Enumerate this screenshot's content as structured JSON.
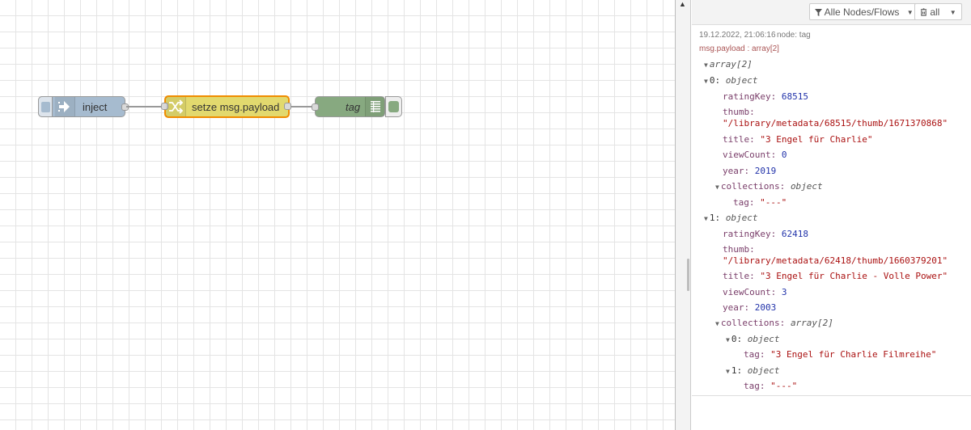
{
  "nodes": {
    "inject": {
      "label": "inject"
    },
    "change": {
      "label": "setze msg.payload"
    },
    "debug": {
      "label": "tag"
    }
  },
  "toolbar": {
    "filter_label": "Alle Nodes/Flows",
    "clear_label": "all"
  },
  "message": {
    "timestamp": "19.12.2022, 21:06:16",
    "node": "node: tag",
    "topic": "msg.payload : array[2]",
    "root_type": "array[2]",
    "items": [
      {
        "index": "0:",
        "type": "object",
        "ratingKey": {
          "k": "ratingKey:",
          "v": "68515"
        },
        "thumb": {
          "k": "thumb:",
          "v": "\"/library/metadata/68515/thumb/1671370868\""
        },
        "title": {
          "k": "title:",
          "v": "\"3 Engel für Charlie\""
        },
        "viewCount": {
          "k": "viewCount:",
          "v": "0"
        },
        "year": {
          "k": "year:",
          "v": "2019"
        },
        "collections": {
          "k": "collections:",
          "type": "object"
        },
        "tag": {
          "k": "tag:",
          "v": "\"---\""
        }
      },
      {
        "index": "1:",
        "type": "object",
        "ratingKey": {
          "k": "ratingKey:",
          "v": "62418"
        },
        "thumb": {
          "k": "thumb:",
          "v": "\"/library/metadata/62418/thumb/1660379201\""
        },
        "title": {
          "k": "title:",
          "v": "\"3 Engel für Charlie - Volle Power\""
        },
        "viewCount": {
          "k": "viewCount:",
          "v": "3"
        },
        "year": {
          "k": "year:",
          "v": "2003"
        },
        "collections": {
          "k": "collections:",
          "type": "array[2]"
        },
        "col0": {
          "index": "0:",
          "type": "object",
          "k": "tag:",
          "v": "\"3 Engel für Charlie Filmreihe\""
        },
        "col1": {
          "index": "1:",
          "type": "object",
          "k": "tag:",
          "v": "\"---\""
        }
      }
    ]
  },
  "colors": {
    "inject": "#a6bbcf",
    "change": "#e2d96e",
    "change_border": "#f08c00",
    "debug": "#87a980"
  },
  "icons": [
    "inject-arrow-icon",
    "shuffle-icon",
    "list-lines-icon",
    "filter-icon",
    "trash-icon",
    "caret-down-icon",
    "scroll-up-arrow-icon"
  ]
}
